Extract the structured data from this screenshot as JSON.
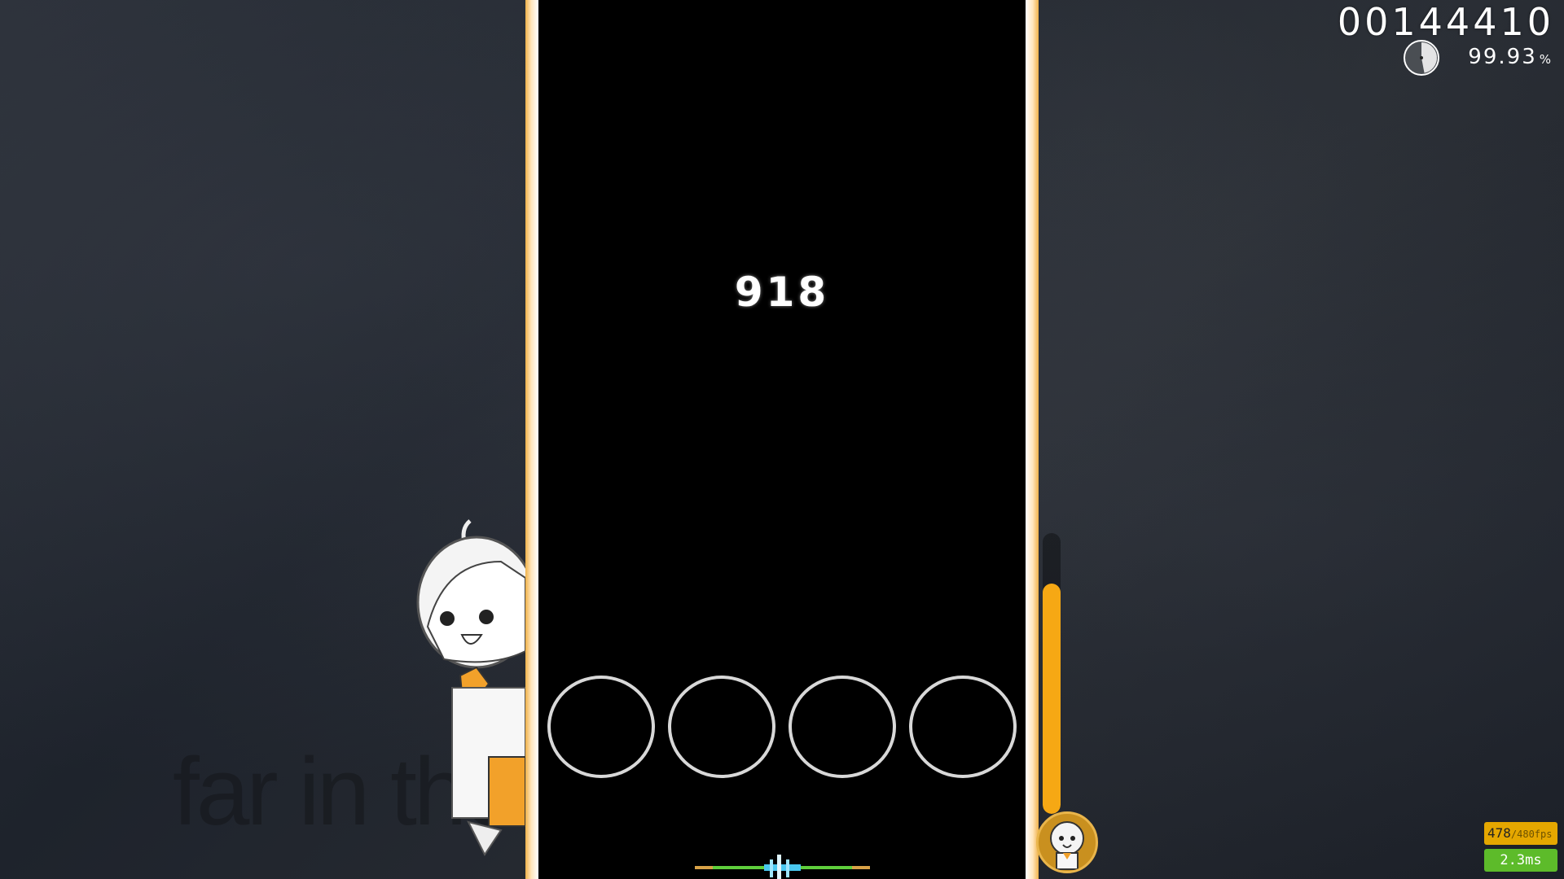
{
  "hud": {
    "score": "00144410",
    "accuracy": "99.93",
    "accuracy_unit": "%",
    "song_progress": 0.47,
    "health": 0.82
  },
  "playfield": {
    "combo": "918",
    "lane_count": 4,
    "accent_color": "#f0b24a"
  },
  "performance": {
    "fps": "478",
    "fps_max": "/480fps",
    "latency": "2.3ms"
  },
  "background": {
    "lyric": "far in the"
  },
  "colors": {
    "health": "#f6a814",
    "fps_bg": "#e5a700",
    "latency_bg": "#5dbb2a",
    "hit_perfect": "#4ac8ef",
    "hit_good": "#5fcf3c",
    "hit_meh": "#d9a247"
  },
  "icons": {
    "progress": "pie-clock-icon",
    "mascot": "chibi-character-icon",
    "health_avatar": "character-avatar-icon"
  }
}
